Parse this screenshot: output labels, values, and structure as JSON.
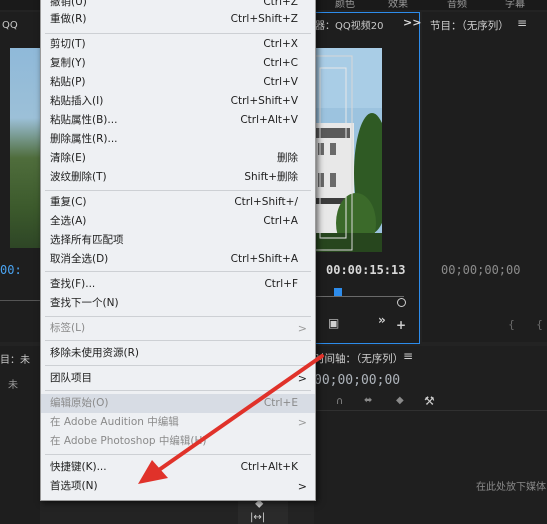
{
  "top_tabs": [
    "颜色",
    "效果",
    "音频",
    "字幕"
  ],
  "source_monitor": {
    "tab_partial": "QQ",
    "timecode_left": "00:",
    "zoom_partial": "未"
  },
  "program_monitor": {
    "tab_label": "器：QQ视频20",
    "timecode": "00:00:15:13",
    "expand_icon": ">>"
  },
  "node_panel": {
    "title": "节目：（无序列）",
    "timecode": "00;00;00;00"
  },
  "timeline": {
    "title": "时间轴：（无序列）",
    "timecode": "00;00;00;00",
    "drop_hint": "在此处放下媒体"
  },
  "left_panel": {
    "tab_partial": "目：未"
  },
  "menu": {
    "items": [
      {
        "label": "撤销(U)",
        "shortcut": "Ctrl+Z",
        "disabled": false
      },
      {
        "label": "重做(R)",
        "shortcut": "Ctrl+Shift+Z",
        "disabled": false
      },
      {
        "label": "剪切(T)",
        "shortcut": "Ctrl+X",
        "disabled": false
      },
      {
        "label": "复制(Y)",
        "shortcut": "Ctrl+C",
        "disabled": false
      },
      {
        "label": "粘贴(P)",
        "shortcut": "Ctrl+V",
        "disabled": false
      },
      {
        "label": "粘贴插入(I)",
        "shortcut": "Ctrl+Shift+V",
        "disabled": false
      },
      {
        "label": "粘贴属性(B)...",
        "shortcut": "Ctrl+Alt+V",
        "disabled": false
      },
      {
        "label": "删除属性(R)...",
        "shortcut": "",
        "disabled": false
      },
      {
        "label": "清除(E)",
        "shortcut": "删除",
        "disabled": false
      },
      {
        "label": "波纹删除(T)",
        "shortcut": "Shift+删除",
        "disabled": false
      },
      {
        "label": "重复(C)",
        "shortcut": "Ctrl+Shift+/",
        "disabled": false
      },
      {
        "label": "全选(A)",
        "shortcut": "Ctrl+A",
        "disabled": false
      },
      {
        "label": "选择所有匹配项",
        "shortcut": "",
        "disabled": false
      },
      {
        "label": "取消全选(D)",
        "shortcut": "Ctrl+Shift+A",
        "disabled": false
      },
      {
        "label": "查找(F)...",
        "shortcut": "Ctrl+F",
        "disabled": false
      },
      {
        "label": "查找下一个(N)",
        "shortcut": "",
        "disabled": false
      },
      {
        "label": "标签(L)",
        "shortcut": "",
        "disabled": true,
        "submenu": true
      },
      {
        "label": "移除未使用资源(R)",
        "shortcut": "",
        "disabled": false
      },
      {
        "label": "团队项目",
        "shortcut": "",
        "disabled": false,
        "submenu": true
      },
      {
        "label": "编辑原始(O)",
        "shortcut": "Ctrl+E",
        "disabled": true
      },
      {
        "label": "在 Adobe Audition 中编辑",
        "shortcut": "",
        "disabled": true,
        "submenu": true
      },
      {
        "label": "在 Adobe Photoshop 中编辑(H)",
        "shortcut": "",
        "disabled": true
      },
      {
        "label": "快捷键(K)...",
        "shortcut": "Ctrl+Alt+K",
        "disabled": false
      },
      {
        "label": "首选项(N)",
        "shortcut": "",
        "disabled": false,
        "submenu": true
      }
    ],
    "submenu_glyph": ">"
  },
  "colors": {
    "arrow": "#e0322a",
    "panel_focus_border": "#2d8ceb",
    "playhead": "#2d8ceb"
  }
}
